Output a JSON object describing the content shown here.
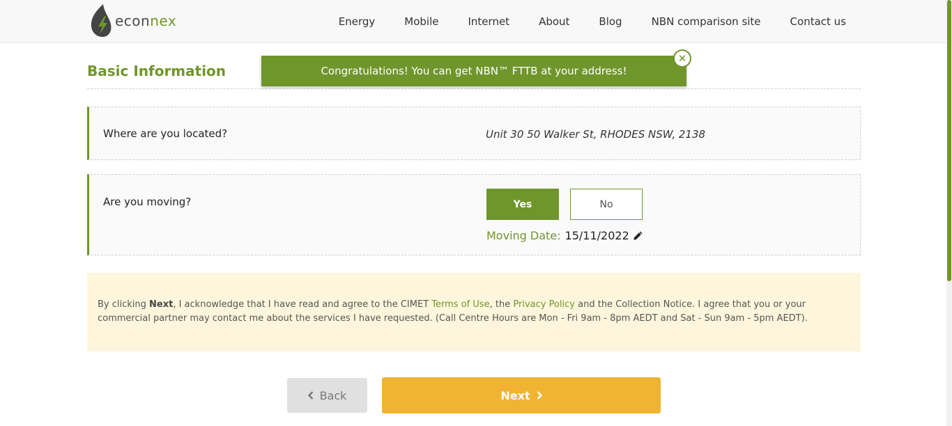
{
  "header": {
    "logo_text_a": "econ",
    "logo_text_b": "nex",
    "nav": [
      "Energy",
      "Mobile",
      "Internet",
      "About",
      "Blog",
      "NBN comparison site",
      "Contact us"
    ]
  },
  "toast": {
    "message": "Congratulations! You can get NBN™ FTTB at your address!",
    "close_icon": "close-icon"
  },
  "section": {
    "title": "Basic Information"
  },
  "location": {
    "label": "Where are you located?",
    "address": "Unit 30 50 Walker St, RHODES NSW, 2138"
  },
  "moving": {
    "label": "Are you moving?",
    "yes_label": "Yes",
    "no_label": "No",
    "selected": "Yes",
    "date_label": "Moving Date:",
    "date_value": "15/11/2022"
  },
  "notice": {
    "part1": "By clicking ",
    "next_bold": "Next",
    "part2": ", I acknowledge that I have read and agree to the CIMET ",
    "terms_link": "Terms of Use",
    "part3": ", the ",
    "privacy_link": "Privacy Policy",
    "part4": " and the Collection Notice. I agree that you or your commercial partner may contact me about the services I have requested. (Call Centre Hours are Mon - Fri 9am - 8pm AEDT and Sat - Sun 9am - 5pm AEDT)."
  },
  "footer_buttons": {
    "back_label": "Back",
    "next_label": "Next"
  },
  "colors": {
    "brand_green": "#6f962b",
    "next_yellow": "#f0b432",
    "notice_bg": "#fdf6dc"
  }
}
